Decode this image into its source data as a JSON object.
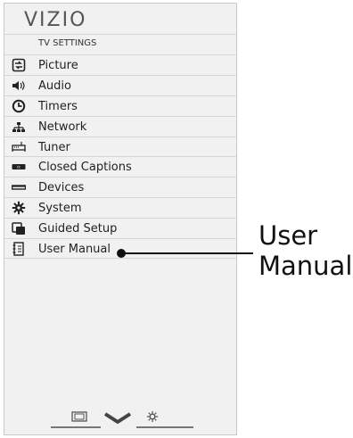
{
  "brand": "VIZIO",
  "section_title": "TV SETTINGS",
  "menu": [
    {
      "label": "Picture",
      "icon": "picture-icon"
    },
    {
      "label": "Audio",
      "icon": "speaker-icon"
    },
    {
      "label": "Timers",
      "icon": "timer-icon"
    },
    {
      "label": "Network",
      "icon": "network-icon"
    },
    {
      "label": "Tuner",
      "icon": "tuner-icon"
    },
    {
      "label": "Closed Captions",
      "icon": "closed-captions-icon"
    },
    {
      "label": "Devices",
      "icon": "devices-icon"
    },
    {
      "label": "System",
      "icon": "gear-icon"
    },
    {
      "label": "Guided Setup",
      "icon": "guided-setup-icon"
    },
    {
      "label": "User Manual",
      "icon": "manual-icon"
    }
  ],
  "callout": {
    "line1": "User",
    "line2": "Manual"
  },
  "bottom_nav": {
    "icons": [
      "widescreen-icon",
      "chevron-down-icon",
      "settings-icon"
    ]
  },
  "colors": {
    "panel": "#f1f1f1",
    "border": "#c8c8c8",
    "text": "#222222"
  }
}
